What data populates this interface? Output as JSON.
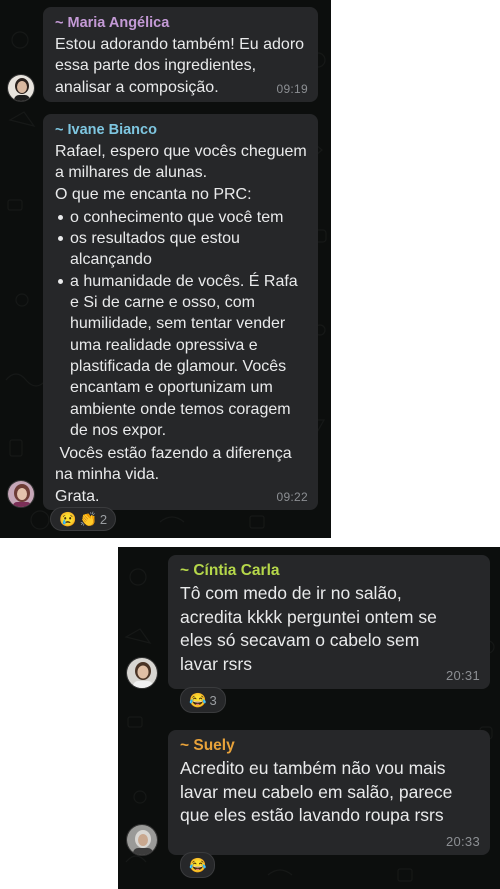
{
  "colors": {
    "background": "#0c0e0d",
    "bubble": "#262729",
    "text": "#e9eaeb",
    "time": "#8c8f93",
    "maria": "#c49ad6",
    "ivane": "#7ec6e0",
    "cintia": "#b5d74a",
    "suely": "#e8a23a"
  },
  "messages": [
    {
      "sender": "~ Maria Angélica",
      "lines": [
        "Estou adorando também! Eu adoro",
        "essa parte dos ingredientes,",
        "analisar a composição."
      ],
      "time": "09:19"
    },
    {
      "sender": "~ Ivane Bianco",
      "intro": [
        "Rafael, espero que vocês cheguem",
        "a milhares de alunas.",
        "O que me encanta no PRC:"
      ],
      "bullets": [
        "o conhecimento que você tem",
        "os resultados que estou alcançando",
        "a humanidade de vocês. É Rafa e Si de carne e osso, com humilidade, sem tentar vender uma realidade opressiva e plastificada de glamour. Vocês encantam e oportunizam um ambiente onde temos coragem de nos expor."
      ],
      "outro": [
        " Vocês estão fazendo a diferença",
        "na minha vida.",
        "Grata."
      ],
      "time": "09:22",
      "reactions": {
        "emojis": [
          "😢",
          "👏"
        ],
        "count": "2"
      }
    },
    {
      "sender": "~ Cíntia Carla",
      "lines": [
        "Tô com medo de ir no salão,",
        "acredita kkkk perguntei ontem se",
        "eles só secavam o cabelo sem",
        "lavar rsrs"
      ],
      "time": "20:31",
      "reactions": {
        "emojis": [
          "😂"
        ],
        "count": "3"
      }
    },
    {
      "sender": "~ Suely",
      "lines": [
        "Acredito eu também não vou mais",
        "lavar meu cabelo em salão, parece",
        "que eles estão lavando roupa rsrs"
      ],
      "time": "20:33",
      "reactions": {
        "emojis": [
          "😂"
        ],
        "count": ""
      }
    }
  ]
}
